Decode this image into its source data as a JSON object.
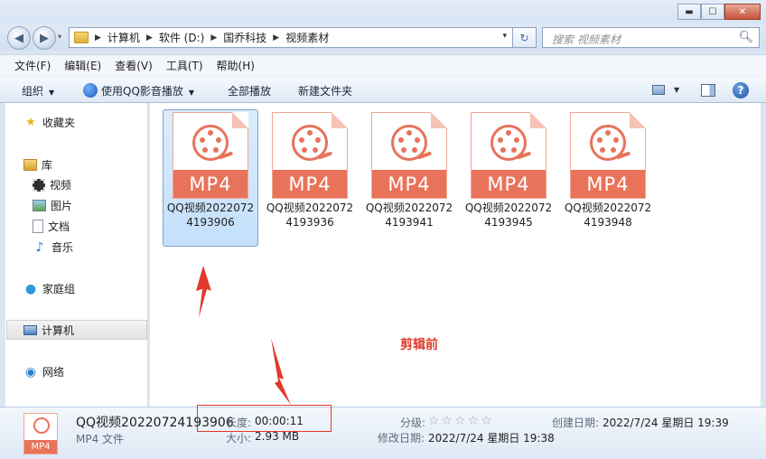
{
  "window": {
    "minimize": "▬",
    "maximize": "☐",
    "close": "✕"
  },
  "nav": {
    "back": "◀",
    "forward": "▶",
    "dropdown": "▾"
  },
  "address": {
    "crumbs": [
      "计算机",
      "软件 (D:)",
      "国乔科技",
      "视频素材"
    ],
    "dropdown": "▾",
    "refresh": "↻"
  },
  "search": {
    "placeholder": "搜索 视频素材",
    "icon": "search-icon"
  },
  "menu": [
    "文件(F)",
    "编辑(E)",
    "查看(V)",
    "工具(T)",
    "帮助(H)"
  ],
  "toolbar": {
    "organize": "组织",
    "play_qq": "使用QQ影音播放",
    "play_all": "全部播放",
    "new_folder": "新建文件夹",
    "help": "?"
  },
  "sidebar": {
    "favorites": "收藏夹",
    "libraries": "库",
    "videos": "视频",
    "pictures": "图片",
    "documents": "文档",
    "music": "音乐",
    "homegroup": "家庭组",
    "computer": "计算机",
    "network": "网络"
  },
  "files": [
    {
      "badge": "MP4",
      "name": "QQ视频20220724193906",
      "selected": true
    },
    {
      "badge": "MP4",
      "name": "QQ视频20220724193936",
      "selected": false
    },
    {
      "badge": "MP4",
      "name": "QQ视频20220724193941",
      "selected": false
    },
    {
      "badge": "MP4",
      "name": "QQ视频20220724193945",
      "selected": false
    },
    {
      "badge": "MP4",
      "name": "QQ视频20220724193948",
      "selected": false
    }
  ],
  "annotation": {
    "label": "剪辑前",
    "color": "#e23a2a"
  },
  "details": {
    "badge": "MP4",
    "name": "QQ视频20220724193906",
    "type": "MP4 文件",
    "length_label": "长度:",
    "length_value": "00:00:11",
    "size_label": "大小:",
    "size_value": "2.93 MB",
    "rating_label": "分级:",
    "rating_stars": "☆☆☆☆☆",
    "modified_label": "修改日期:",
    "modified_value": "2022/7/24 星期日 19:38",
    "created_label": "创建日期:",
    "created_value": "2022/7/24 星期日 19:39"
  },
  "colors": {
    "mp4_accent": "#e8735a",
    "selection": "#c4e0fc",
    "annotation_red": "#e23a2a"
  }
}
